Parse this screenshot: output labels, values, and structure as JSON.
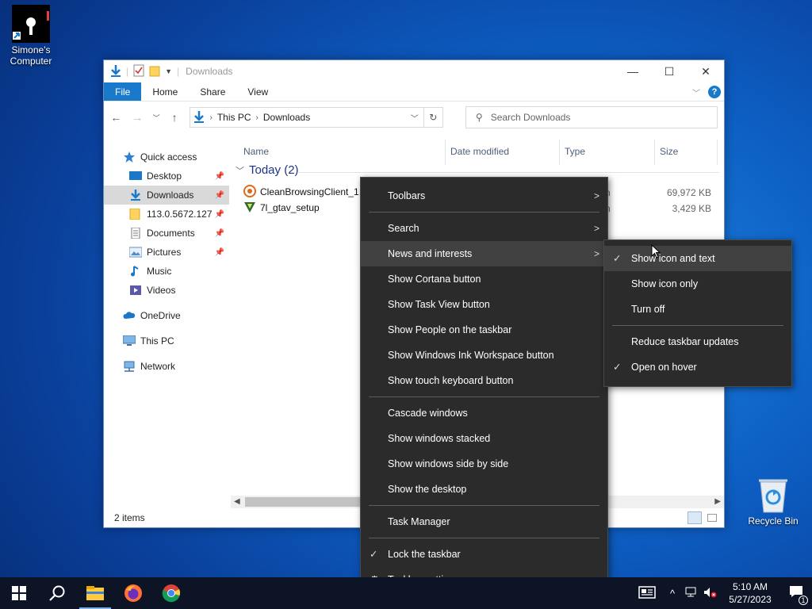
{
  "desktop": {
    "icons": [
      {
        "label": "Simone's Computer"
      },
      {
        "label": "Recycle Bin"
      }
    ]
  },
  "explorer": {
    "title": "Downloads",
    "ribbon_tabs": [
      "File",
      "Home",
      "Share",
      "View"
    ],
    "address": {
      "crumbs": [
        "This PC",
        "Downloads"
      ]
    },
    "search_placeholder": "Search Downloads",
    "nav": [
      {
        "label": "Quick access",
        "icon": "star-icon"
      },
      {
        "label": "Desktop",
        "icon": "desktop-folder-icon",
        "pinned": true
      },
      {
        "label": "Downloads",
        "icon": "download-arrow-icon",
        "pinned": true,
        "selected": true
      },
      {
        "label": "113.0.5672.127",
        "icon": "folder-icon",
        "pinned": true
      },
      {
        "label": "Documents",
        "icon": "documents-icon",
        "pinned": true
      },
      {
        "label": "Pictures",
        "icon": "pictures-icon",
        "pinned": true
      },
      {
        "label": "Music",
        "icon": "music-icon"
      },
      {
        "label": "Videos",
        "icon": "videos-icon"
      },
      {
        "label": "OneDrive",
        "icon": "cloud-icon"
      },
      {
        "label": "This PC",
        "icon": "monitor-icon"
      },
      {
        "label": "Network",
        "icon": "network-icon"
      }
    ],
    "columns": [
      "Name",
      "Date modified",
      "Type",
      "Size"
    ],
    "group": {
      "label": "Today (2)"
    },
    "files": [
      {
        "name": "CleanBrowsingClient_1.5",
        "type": "n",
        "size": "69,972 KB"
      },
      {
        "name": "7l_gtav_setup",
        "type": "n",
        "size": "3,429 KB"
      }
    ],
    "status": "2 items"
  },
  "context_menu": {
    "items": [
      {
        "label": "Toolbars",
        "submenu": true
      },
      {
        "sep": true
      },
      {
        "label": "Search",
        "submenu": true
      },
      {
        "label": "News and interests",
        "submenu": true,
        "highlighted": true
      },
      {
        "label": "Show Cortana button"
      },
      {
        "label": "Show Task View button"
      },
      {
        "label": "Show People on the taskbar"
      },
      {
        "label": "Show Windows Ink Workspace button"
      },
      {
        "label": "Show touch keyboard button"
      },
      {
        "sep": true
      },
      {
        "label": "Cascade windows"
      },
      {
        "label": "Show windows stacked"
      },
      {
        "label": "Show windows side by side"
      },
      {
        "label": "Show the desktop"
      },
      {
        "sep": true
      },
      {
        "label": "Task Manager"
      },
      {
        "sep": true
      },
      {
        "label": "Lock the taskbar",
        "checked": true
      },
      {
        "label": "Taskbar settings",
        "icon": "gear-icon"
      }
    ]
  },
  "submenu": {
    "items": [
      {
        "label": "Show icon and text",
        "checked": true,
        "highlighted": true
      },
      {
        "label": "Show icon only"
      },
      {
        "label": "Turn off"
      },
      {
        "sep": true
      },
      {
        "label": "Reduce taskbar updates"
      },
      {
        "label": "Open on hover",
        "checked": true
      }
    ]
  },
  "taskbar": {
    "clock": {
      "time": "5:10 AM",
      "date": "5/27/2023"
    },
    "notification_count": "1"
  },
  "colors": {
    "accent": "#1979ca",
    "menu_bg": "#2b2b2b",
    "taskbar_bg": "#0c1426"
  }
}
